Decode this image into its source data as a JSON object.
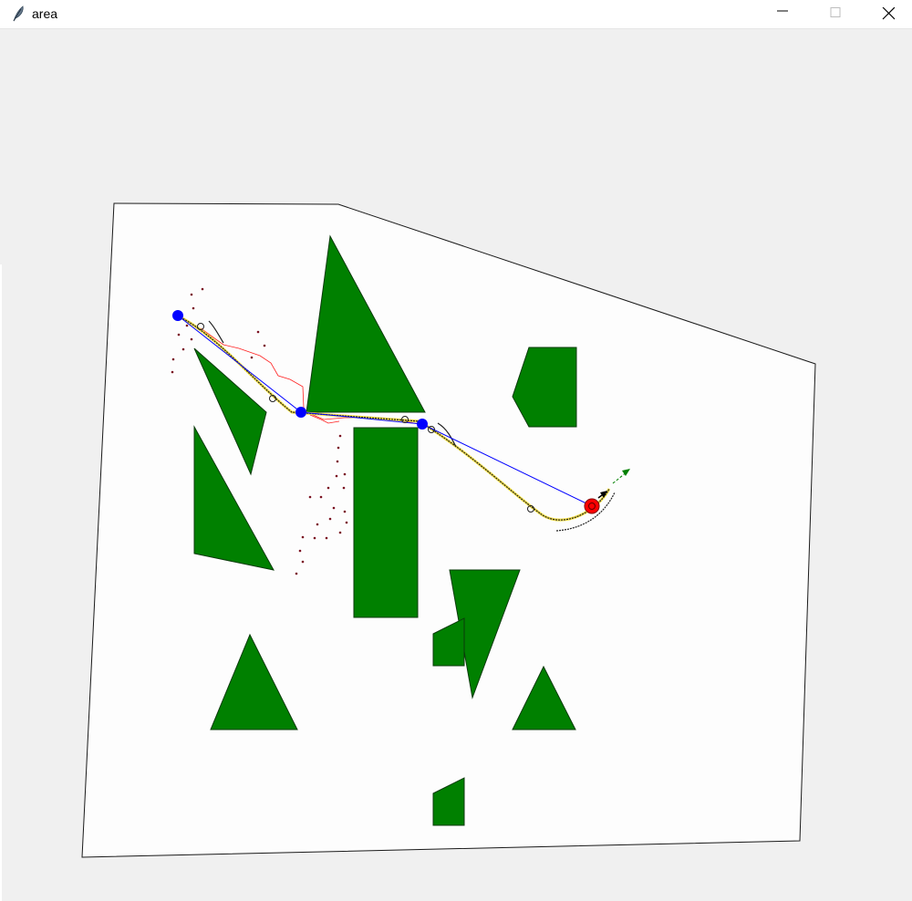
{
  "window": {
    "title": "area"
  },
  "icons": {
    "app": "feather-icon",
    "minimize": "minimize-icon",
    "maximize": "maximize-icon",
    "close": "close-icon"
  },
  "colors": {
    "obstacle_fill": "#008000",
    "area_fill": "#fdfdfd",
    "waypoint": "#0000ff",
    "goal": "#ff0000",
    "planned_path": "#0000ff",
    "explored_path": "#ff0000",
    "heading_arrow": "#008000"
  }
}
